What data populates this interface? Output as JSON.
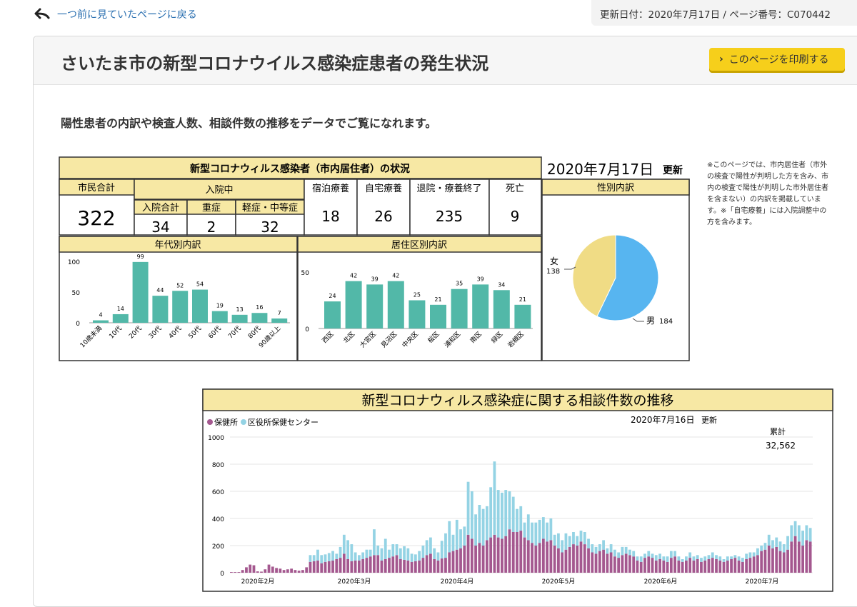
{
  "nav": {
    "back_label": "一つ前に見ていたページに戻る",
    "meta": "更新日付：2020年7月17日 / ページ番号：C070442"
  },
  "page": {
    "title": "さいたま市の新型コロナウイルス感染症患者の発生状況",
    "print_label": "このページを印刷する",
    "lead": "陽性患者の内訳や検査人数、相談件数の推移をデータでご覧になれます。"
  },
  "status": {
    "table_title": "新型コロナウィルス感染者（市内居住者）の状況",
    "update_date": "2020年7月17日",
    "update_label": "更新",
    "total_label": "市民合計",
    "total_value": "322",
    "hospital_label": "入院中",
    "hosp_total_label": "入院合計",
    "hosp_total_value": "34",
    "severe_label": "重症",
    "severe_value": "2",
    "mild_label": "軽症・中等症",
    "mild_value": "32",
    "hotel_label": "宿泊療養",
    "hotel_value": "18",
    "home_label": "自宅療養",
    "home_value": "26",
    "discharged_label": "退院・療養終了",
    "discharged_value": "235",
    "death_label": "死亡",
    "death_value": "9"
  },
  "note": "※このページでは、市内居住者（市外の検査で陽性が判明した方を含み、市内の検査で陽性が判明した市外居住者を含まない）の内訳を掲載しています。※「自宅療養」には入院調整中の方を含みます。",
  "colors": {
    "teal": "#52b8a8",
    "yellow_header": "#f7e8a4",
    "pie_male": "#57b5f0",
    "pie_female": "#f0dc85",
    "hc": "#a4588f",
    "ward": "#94d3e4"
  },
  "chart_data": [
    {
      "type": "bar",
      "title": "年代別内訳",
      "categories": [
        "10歳未満",
        "10代",
        "20代",
        "30代",
        "40代",
        "50代",
        "60代",
        "70代",
        "80代",
        "90歳以上"
      ],
      "values": [
        4,
        14,
        99,
        44,
        52,
        54,
        19,
        13,
        16,
        7
      ],
      "yticks": [
        "0",
        "50",
        "100"
      ],
      "ylim": [
        0,
        100
      ]
    },
    {
      "type": "bar",
      "title": "居住区別内訳",
      "categories": [
        "西区",
        "北区",
        "大宮区",
        "見沼区",
        "中央区",
        "桜区",
        "浦和区",
        "南区",
        "緑区",
        "岩槻区"
      ],
      "values": [
        24,
        42,
        39,
        42,
        25,
        21,
        35,
        39,
        34,
        21
      ],
      "yticks": [
        "0",
        "50"
      ],
      "ylim": [
        0,
        50
      ]
    },
    {
      "type": "pie",
      "title": "性別内訳",
      "labels": [
        "男",
        "女"
      ],
      "values": [
        184,
        138
      ]
    },
    {
      "type": "bar",
      "title": "新型コロナウィルス感染症に関する相談件数の推移",
      "update": "2020年7月16日",
      "update_label": "更新",
      "legend": [
        "保健所",
        "区役所保健センター"
      ],
      "cumulative_label": "累計",
      "cumulative_value": "32,562",
      "yticks": [
        "0",
        "200",
        "400",
        "600",
        "800",
        "1000"
      ],
      "ylim": [
        0,
        1000
      ],
      "x_labels": [
        "2020年2月",
        "2020年3月",
        "2020年4月",
        "2020年5月",
        "2020年6月",
        "2020年7月"
      ],
      "series": [
        {
          "name": "保健所",
          "values": [
            5,
            5,
            5,
            20,
            40,
            60,
            55,
            10,
            8,
            25,
            60,
            45,
            35,
            30,
            20,
            25,
            30,
            20,
            15,
            20,
            40,
            80,
            85,
            90,
            70,
            80,
            85,
            90,
            100,
            110,
            140,
            100,
            85,
            90,
            90,
            100,
            110,
            120,
            130,
            130,
            90,
            100,
            110,
            120,
            130,
            100,
            95,
            90,
            80,
            85,
            90,
            110,
            130,
            140,
            100,
            90,
            105,
            110,
            150,
            160,
            170,
            180,
            200,
            280,
            250,
            200,
            220,
            200,
            240,
            260,
            280,
            260,
            250,
            270,
            320,
            300,
            300,
            310,
            260,
            240,
            220,
            200,
            220,
            250,
            230,
            240,
            200,
            180,
            150,
            170,
            190,
            210,
            200,
            230,
            210,
            180,
            150,
            140,
            160,
            170,
            140,
            150,
            120,
            110,
            130,
            140,
            130,
            120,
            90,
            80,
            110,
            120,
            110,
            90,
            100,
            90,
            80,
            110,
            120,
            90,
            80,
            90,
            110,
            90,
            100,
            80,
            90,
            100,
            110,
            100,
            90,
            80,
            90,
            100,
            110,
            90,
            80,
            100,
            110,
            120,
            130,
            160,
            170,
            200,
            180,
            190,
            160,
            150,
            170,
            230,
            270,
            230,
            200,
            240,
            230
          ]
        },
        {
          "name": "区役所保健センター",
          "values": [
            0,
            0,
            0,
            0,
            0,
            0,
            0,
            0,
            0,
            0,
            0,
            0,
            0,
            0,
            0,
            0,
            0,
            0,
            0,
            0,
            0,
            50,
            45,
            80,
            60,
            55,
            60,
            70,
            40,
            80,
            140,
            140,
            125,
            60,
            40,
            50,
            60,
            50,
            190,
            70,
            90,
            150,
            60,
            90,
            80,
            80,
            100,
            90,
            60,
            50,
            70,
            90,
            110,
            120,
            80,
            60,
            130,
            180,
            230,
            120,
            220,
            140,
            140,
            390,
            350,
            230,
            280,
            270,
            250,
            370,
            540,
            350,
            340,
            340,
            280,
            260,
            170,
            180,
            110,
            190,
            150,
            170,
            170,
            160,
            140,
            160,
            80,
            110,
            90,
            120,
            80,
            90,
            70,
            80,
            90,
            70,
            60,
            50,
            50,
            70,
            40,
            60,
            50,
            40,
            60,
            50,
            40,
            40,
            30,
            40,
            30,
            40,
            30,
            40,
            40,
            30,
            40,
            50,
            40,
            30,
            20,
            30,
            40,
            30,
            30,
            30,
            30,
            30,
            40,
            30,
            30,
            20,
            30,
            20,
            20,
            30,
            30,
            40,
            40,
            30,
            50,
            40,
            50,
            80,
            60,
            70,
            70,
            60,
            100,
            120,
            110,
            120,
            110,
            110,
            100
          ]
        }
      ]
    }
  ]
}
